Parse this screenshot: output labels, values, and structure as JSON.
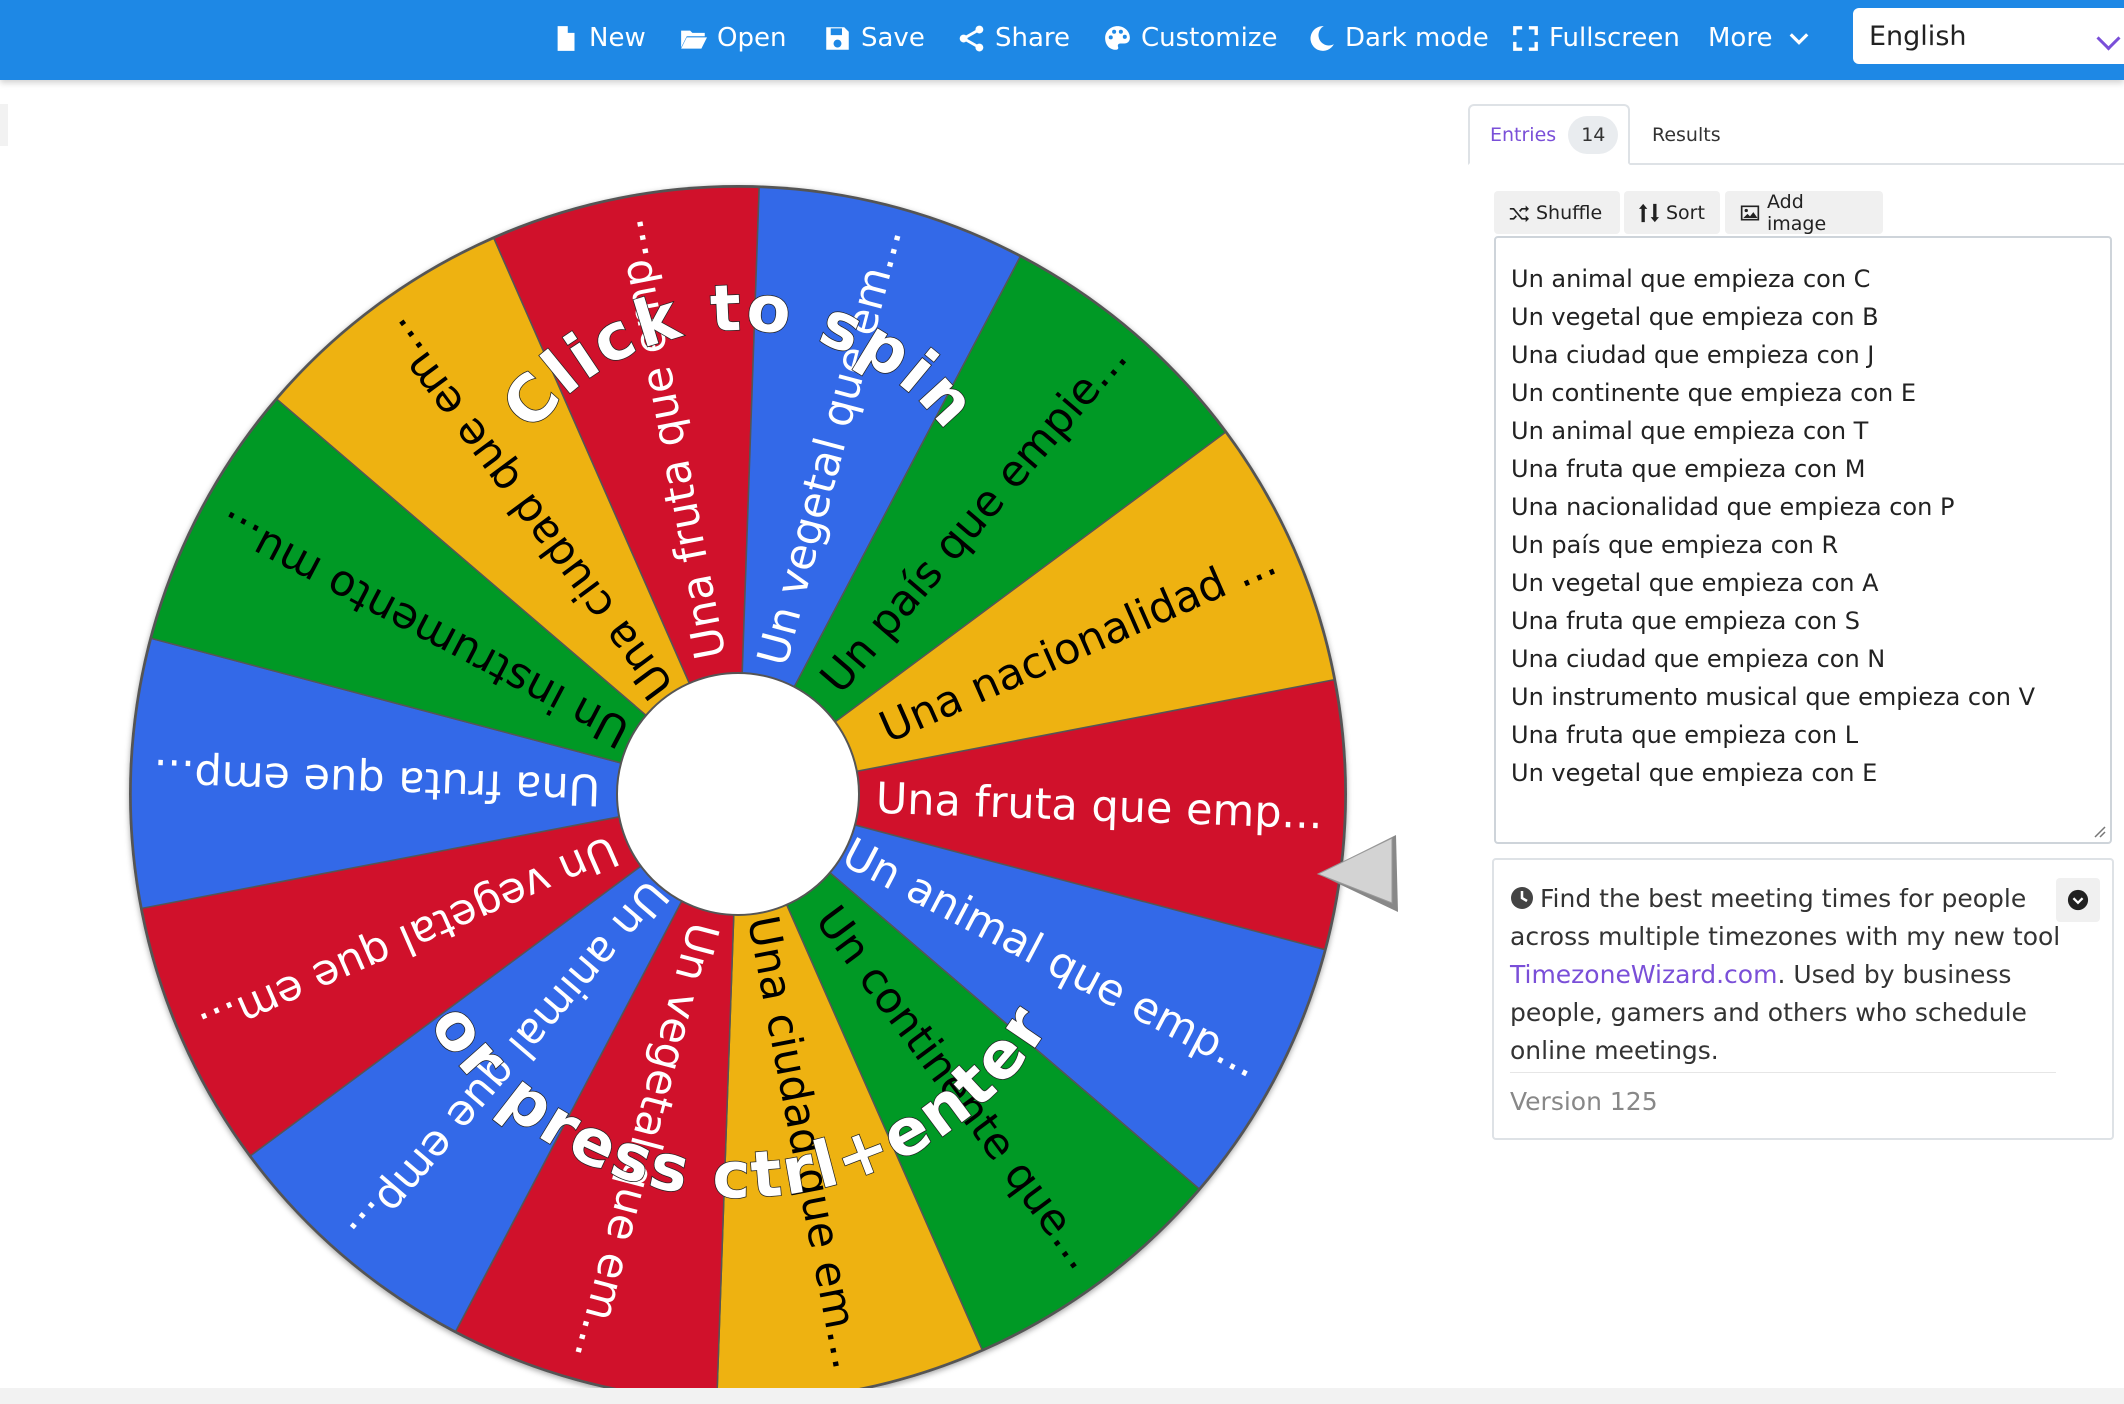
{
  "topbar": {
    "menu": [
      {
        "label": "New",
        "icon": "file-icon"
      },
      {
        "label": "Open",
        "icon": "folder-open-icon"
      },
      {
        "label": "Save",
        "icon": "floppy-disk-icon"
      },
      {
        "label": "Share",
        "icon": "share-icon"
      },
      {
        "label": "Customize",
        "icon": "palette-icon"
      },
      {
        "label": "Dark mode",
        "icon": "moon-icon"
      },
      {
        "label": "Fullscreen",
        "icon": "expand-icon"
      },
      {
        "label": "More",
        "icon": "chevron-down-icon"
      }
    ],
    "language": "English"
  },
  "wheel": {
    "overlay_line1": "Click to spin",
    "overlay_line2": "or press ctrl+enter",
    "slice_labels": [
      "Una fruta que emp...",
      "Un animal que emp...",
      "Un continente que...",
      "Una ciudad que em...",
      "Un vegetal que em...",
      "Un animal que emp...",
      "Un vegetal que em...",
      "Una fruta que emp...",
      "Un instrumento mu...",
      "Una ciudad que em...",
      "Una fruta que emp...",
      "Un vegetal que em...",
      "Un país que empie...",
      "Una nacionalidad ..."
    ],
    "colors": {
      "red": "#d0112b",
      "blue": "#3369e8",
      "green": "#009925",
      "yellow": "#eeb211"
    },
    "slice_colors": [
      "red",
      "blue",
      "green",
      "yellow",
      "red",
      "blue",
      "red",
      "blue",
      "green",
      "yellow",
      "red",
      "blue",
      "green",
      "yellow"
    ],
    "slice_text_colors": [
      "#ffffff",
      "#ffffff",
      "#000000",
      "#000000",
      "#ffffff",
      "#ffffff",
      "#ffffff",
      "#ffffff",
      "#000000",
      "#000000",
      "#ffffff",
      "#ffffff",
      "#000000",
      "#000000"
    ]
  },
  "sidebar": {
    "tabs": {
      "entries_label": "Entries",
      "entries_count": "14",
      "results_label": "Results"
    },
    "buttons": {
      "shuffle": "Shuffle",
      "sort": "Sort",
      "add_image": "Add image"
    },
    "entries": [
      "Un animal que empieza con C",
      "Un vegetal que empieza con B",
      "Una ciudad que empieza con J",
      "Un continente que empieza con E",
      "Un animal que empieza con T",
      "Una fruta que empieza con M",
      "Una nacionalidad que empieza con P",
      "Un país que empieza con R",
      "Un vegetal que empieza con A",
      "Una fruta que empieza con S",
      "Una ciudad que empieza con N",
      "Un instrumento musical que empieza con V",
      "Una fruta que empieza con L",
      "Un vegetal que empieza con E"
    ],
    "info": {
      "text_before": "Find the best meeting times for people across multiple timezones with my new tool ",
      "link": "TimezoneWizard.com",
      "text_after": ". Used by business people, gamers and others who schedule online meetings.",
      "version": "Version 125"
    }
  }
}
